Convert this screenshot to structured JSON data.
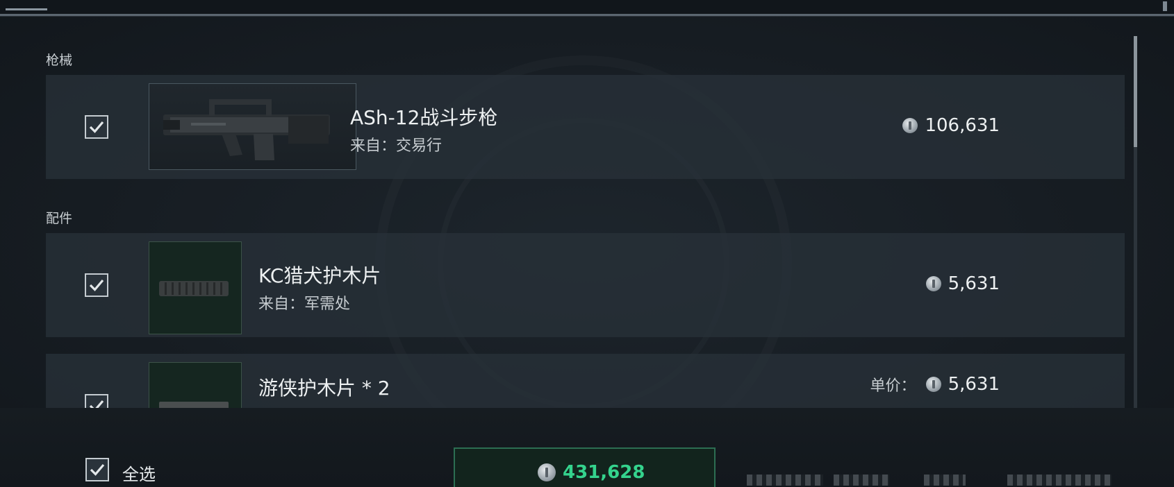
{
  "sections": {
    "guns_label": "枪械",
    "parts_label": "配件"
  },
  "items": [
    {
      "name": "ASh-12战斗步枪",
      "source": "来自：交易行",
      "price": "106,631",
      "icon": "rifle-thumbnail"
    },
    {
      "name": "KC猎犬护木片",
      "source": "来自：军需处",
      "price": "5,631",
      "icon": "handguard-thumbnail"
    },
    {
      "name": "游侠护木片 * 2",
      "unit_label": "单价：",
      "price": "5,631",
      "icon": "handguard-thumbnail"
    }
  ],
  "footer": {
    "select_all_label": "全选",
    "total": "431,628"
  },
  "colors": {
    "accent_green": "#34d38d",
    "card_bg": "#283139",
    "background": "#171d23"
  },
  "icons": {
    "checkbox": "checkmark-icon",
    "currency": "coin-icon"
  }
}
